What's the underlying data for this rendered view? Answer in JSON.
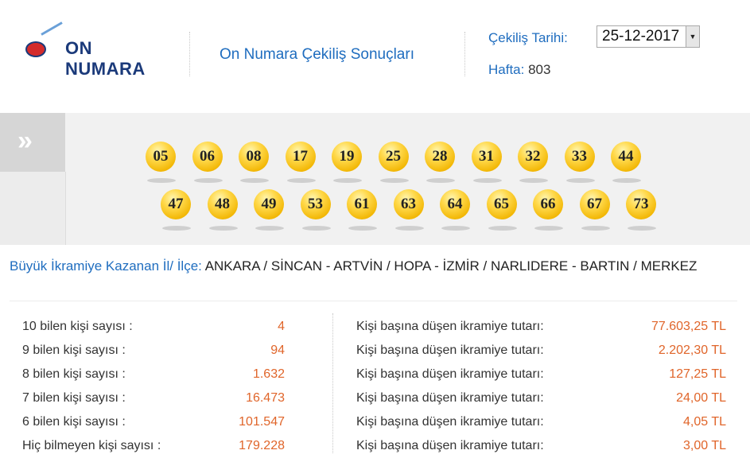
{
  "header": {
    "logo_text": "ON NUMARA",
    "title": "On Numara Çekiliş Sonuçları",
    "date_label": "Çekiliş Tarihi:",
    "date_value": "25-12-2017",
    "week_label": "Hafta:",
    "week_value": "803"
  },
  "balls": {
    "row1": [
      "05",
      "06",
      "08",
      "17",
      "19",
      "25",
      "28",
      "31",
      "32",
      "33",
      "44"
    ],
    "row2": [
      "47",
      "48",
      "49",
      "53",
      "61",
      "63",
      "64",
      "65",
      "66",
      "67",
      "73"
    ]
  },
  "prize_city": {
    "label": "Büyük İkramiye Kazanan İl/ İlçe:",
    "value": "ANKARA / SİNCAN - ARTVİN / HOPA - İZMİR / NARLIDERE - BARTIN / MERKEZ"
  },
  "stats": [
    {
      "label": "10 bilen kişi sayısı :",
      "count": "4",
      "prize_label": "Kişi başına düşen ikramiye tutarı:",
      "prize": "77.603,25 TL"
    },
    {
      "label": "9 bilen kişi sayısı :",
      "count": "94",
      "prize_label": "Kişi başına düşen ikramiye tutarı:",
      "prize": "2.202,30 TL"
    },
    {
      "label": "8 bilen kişi sayısı :",
      "count": "1.632",
      "prize_label": "Kişi başına düşen ikramiye tutarı:",
      "prize": "127,25 TL"
    },
    {
      "label": "7 bilen kişi sayısı :",
      "count": "16.473",
      "prize_label": "Kişi başına düşen ikramiye tutarı:",
      "prize": "24,00 TL"
    },
    {
      "label": "6 bilen kişi sayısı :",
      "count": "101.547",
      "prize_label": "Kişi başına düşen ikramiye tutarı:",
      "prize": "4,05 TL"
    },
    {
      "label": "Hiç bilmeyen kişi sayısı :",
      "count": "179.228",
      "prize_label": "Kişi başına düşen ikramiye tutarı:",
      "prize": "3,00 TL"
    }
  ],
  "colors": {
    "accent_blue": "#1f6dbf",
    "value_orange": "#e0652a",
    "ball_yellow": "#f2b705"
  },
  "icons": {
    "nav": "double-chevron-right-icon",
    "dropdown": "dropdown-arrow-icon"
  }
}
